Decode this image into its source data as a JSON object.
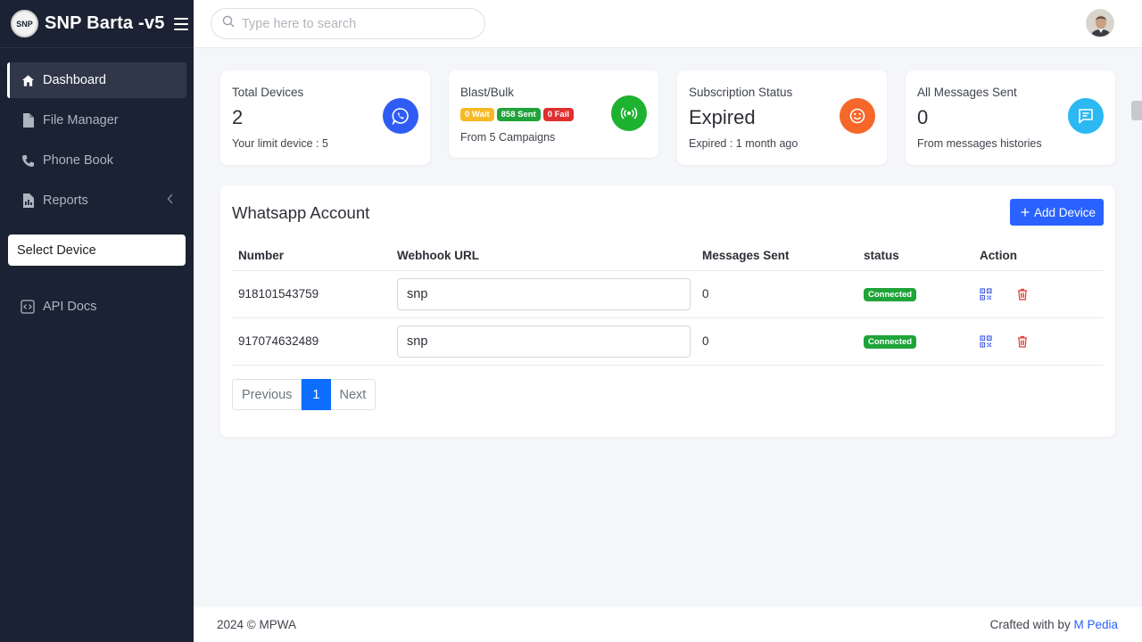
{
  "app": {
    "title": "SNP Barta -v5",
    "logo_text": "SNP"
  },
  "sidebar": {
    "items": [
      {
        "label": "Dashboard",
        "icon": "home-icon"
      },
      {
        "label": "File Manager",
        "icon": "file-icon"
      },
      {
        "label": "Phone Book",
        "icon": "phone-icon"
      },
      {
        "label": "Reports",
        "icon": "report-icon"
      }
    ],
    "select_device": "Select Device",
    "api_docs": "API Docs"
  },
  "topbar": {
    "search_placeholder": "Type here to search"
  },
  "stats": {
    "total_devices": {
      "label": "Total Devices",
      "value": "2",
      "sub": "Your limit device : 5",
      "color": "#2f5cf5"
    },
    "blast": {
      "label": "Blast/Bulk",
      "wait": "0 Wait",
      "sent": "858 Sent",
      "fail": "0 Fail",
      "sub": "From 5 Campaigns",
      "color": "#1db230"
    },
    "subscription": {
      "label": "Subscription Status",
      "value": "Expired",
      "sub": "Expired : 1 month ago",
      "color": "#f5682a"
    },
    "messages": {
      "label": "All Messages Sent",
      "value": "0",
      "sub": "From messages histories",
      "color": "#2bb8f3"
    }
  },
  "accounts": {
    "title": "Whatsapp Account",
    "add_button": "Add Device",
    "columns": [
      "Number",
      "Webhook URL",
      "Messages Sent",
      "status",
      "Action"
    ],
    "rows": [
      {
        "number": "918101543759",
        "webhook": "snp",
        "messages_sent": "0",
        "status": "Connected"
      },
      {
        "number": "917074632489",
        "webhook": "snp",
        "messages_sent": "0",
        "status": "Connected"
      }
    ],
    "pagination": {
      "previous": "Previous",
      "current": "1",
      "next": "Next"
    }
  },
  "footer": {
    "left": "2024 © MPWA",
    "right_prefix": "Crafted with by",
    "right_link": "M Pedia"
  }
}
